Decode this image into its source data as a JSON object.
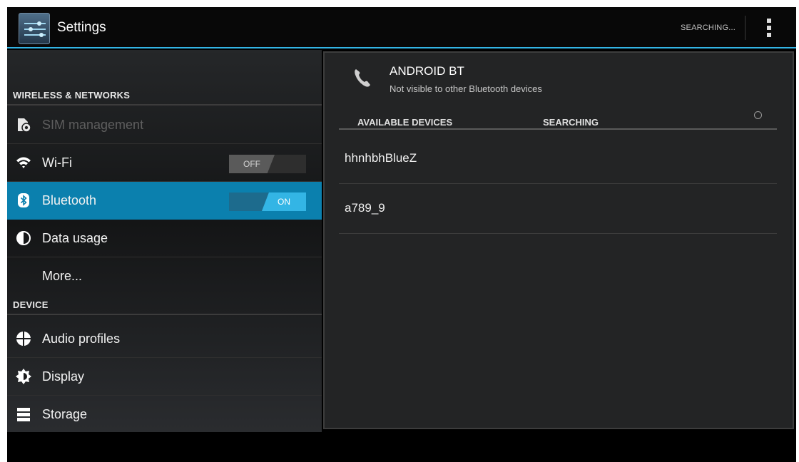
{
  "app": {
    "title": "Settings"
  },
  "actionbar": {
    "status": "SEARCHING..."
  },
  "sidebar": {
    "sections": [
      {
        "header": "WIRELESS & NETWORKS"
      },
      {
        "header": "DEVICE"
      }
    ],
    "items": [
      {
        "label": "SIM management",
        "icon": "sim-management-icon",
        "enabled": false
      },
      {
        "label": "Wi-Fi",
        "icon": "wifi-icon",
        "toggle": "OFF"
      },
      {
        "label": "Bluetooth",
        "icon": "bluetooth-icon",
        "toggle": "ON",
        "selected": true
      },
      {
        "label": "Data usage",
        "icon": "data-usage-icon"
      },
      {
        "label": "More..."
      },
      {
        "label": "Audio profiles",
        "icon": "audio-profiles-icon"
      },
      {
        "label": "Display",
        "icon": "display-icon"
      },
      {
        "label": "Storage",
        "icon": "storage-icon"
      }
    ]
  },
  "bluetooth": {
    "device_name": "ANDROID BT",
    "device_status": "Not visible to other Bluetooth devices",
    "available_header": "AVAILABLE DEVICES",
    "available_status": "SEARCHING",
    "devices": [
      {
        "name": "hhnhbhBlueZ"
      },
      {
        "name": "a789_9"
      }
    ]
  },
  "colors": {
    "accent": "#33b5e5",
    "selected": "#0b80ae",
    "background": "#000000"
  }
}
